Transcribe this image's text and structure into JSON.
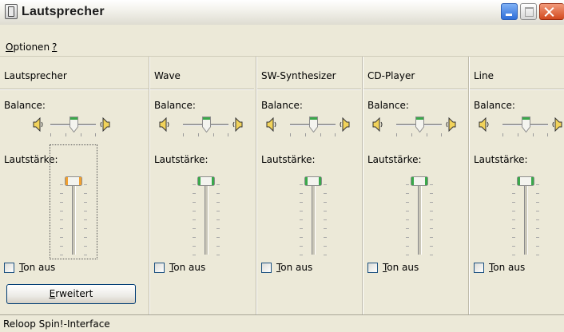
{
  "window": {
    "title": "Lautsprecher"
  },
  "menu": {
    "options_label": "Optionen",
    "options_mnemonic": "O",
    "options_rest": "ptionen",
    "help_label": "?"
  },
  "balance_label": "Balance:",
  "volume_label": "Lautstärke:",
  "mute_label": "Ton aus",
  "mute_mnemonic": "T",
  "mute_rest": "on aus",
  "channels": [
    {
      "name": "Lautsprecher",
      "balance": 0.5,
      "volume": 1.0,
      "muted": false,
      "focused": true
    },
    {
      "name": "Wave",
      "balance": 0.5,
      "volume": 1.0,
      "muted": false,
      "focused": false
    },
    {
      "name": "SW-Synthesizer",
      "balance": 0.5,
      "volume": 1.0,
      "muted": false,
      "focused": false
    },
    {
      "name": "CD-Player",
      "balance": 0.5,
      "volume": 1.0,
      "muted": false,
      "focused": false
    },
    {
      "name": "Line",
      "balance": 0.5,
      "volume": 1.0,
      "muted": false,
      "focused": false
    }
  ],
  "advanced_button": {
    "label": "Erweitert",
    "mnemonic": "E",
    "rest": "rweitert"
  },
  "statusbar": {
    "text": "Reloop Spin!-Interface"
  },
  "colors": {
    "thumb_green": "#3aa84a",
    "thumb_orange": "#f0a030",
    "window_bg": "#ece9d8"
  }
}
